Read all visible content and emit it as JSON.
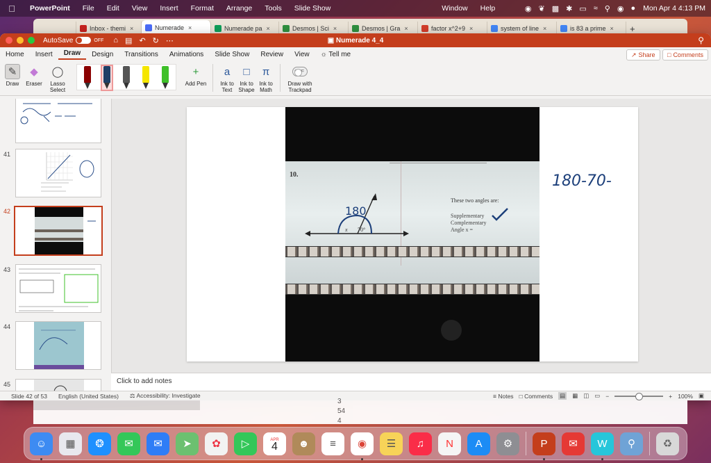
{
  "menubar": {
    "app_name": "PowerPoint",
    "items": [
      "File",
      "Edit",
      "View",
      "Insert",
      "Format",
      "Arrange",
      "Tools",
      "Slide Show",
      "Window",
      "Help"
    ],
    "clock": "Mon Apr 4  4:13 PM"
  },
  "browser_tabs": [
    {
      "label": "Inbox - themi",
      "color": "#c5221f"
    },
    {
      "label": "Numerade",
      "color": "#4a6cf7",
      "active": true
    },
    {
      "label": "Numerade pa",
      "color": "#0f9d58"
    },
    {
      "label": "Desmos | Sci",
      "color": "#2f8f3f"
    },
    {
      "label": "Desmos | Gra",
      "color": "#2f8f3f"
    },
    {
      "label": "factor x^2+9",
      "color": "#d23d2a"
    },
    {
      "label": "system of line",
      "color": "#4285f4"
    },
    {
      "label": "is 83 a prime",
      "color": "#4285f4"
    }
  ],
  "window": {
    "autosave_label": "AutoSave",
    "autosave_state": "OFF",
    "doc_title": "Numerade 4_4"
  },
  "ribbon_tabs": [
    "Home",
    "Insert",
    "Draw",
    "Design",
    "Transitions",
    "Animations",
    "Slide Show",
    "Review",
    "View",
    "Tell me"
  ],
  "ribbon_active_tab": "Draw",
  "share_label": "Share",
  "comments_label": "Comments",
  "ribbon_tools": {
    "draw": "Draw",
    "eraser": "Eraser",
    "lasso": "Lasso Select",
    "add_pen": "Add Pen",
    "ink_to_text": "Ink to Text",
    "ink_to_shape": "Ink to Shape",
    "ink_to_math": "Ink to Math",
    "draw_trackpad": "Draw with Trackpad",
    "trackpad_state": "OFF"
  },
  "pens": [
    {
      "color": "#8b0000"
    },
    {
      "color": "#1f3f66",
      "selected": true
    },
    {
      "color": "#555555"
    },
    {
      "color": "#f5e600"
    },
    {
      "color": "#3fc02a"
    }
  ],
  "thumbnails": [
    {
      "num": ""
    },
    {
      "num": "41"
    },
    {
      "num": "42",
      "active": true
    },
    {
      "num": "43"
    },
    {
      "num": "44"
    },
    {
      "num": "45"
    }
  ],
  "slide": {
    "problem_number": "10.",
    "handwritten_top": "180",
    "angle_x": "x",
    "angle_70": "70°",
    "q_title": "These two angles are:",
    "opt1": "Supplementary",
    "opt2": "Complementary",
    "opt3": "Angle x = ",
    "handwritten_right": "180-70-"
  },
  "notes_placeholder": "Click to add notes",
  "status": {
    "slide_info": "Slide 42 of 53",
    "language": "English (United States)",
    "accessibility": "Accessibility: Investigate",
    "notes": "Notes",
    "comments": "Comments",
    "zoom": "100%"
  },
  "behind_numbers": [
    "3",
    "54",
    "4"
  ],
  "dock_apps": [
    {
      "name": "Finder",
      "color": "#3d8bf2"
    },
    {
      "name": "Launchpad",
      "color": "#e8e8ee"
    },
    {
      "name": "Safari",
      "color": "#1e90ff"
    },
    {
      "name": "Messages",
      "color": "#34c759"
    },
    {
      "name": "Mail",
      "color": "#2f7df6"
    },
    {
      "name": "Maps",
      "color": "#6cc070"
    },
    {
      "name": "Photos",
      "color": "#f2f2f2"
    },
    {
      "name": "FaceTime",
      "color": "#34c759"
    },
    {
      "name": "Calendar",
      "color": "#ffffff"
    },
    {
      "name": "Contacts",
      "color": "#b08a5a"
    },
    {
      "name": "Reminders",
      "color": "#ffffff"
    },
    {
      "name": "Chrome",
      "color": "#ffffff"
    },
    {
      "name": "Notes",
      "color": "#f7d358"
    },
    {
      "name": "Music",
      "color": "#fa2d48"
    },
    {
      "name": "News",
      "color": "#f5f5f5"
    },
    {
      "name": "App Store",
      "color": "#1c8cf5"
    },
    {
      "name": "System Preferences",
      "color": "#8e8e93"
    },
    {
      "name": "PowerPoint",
      "color": "#c43e1c"
    },
    {
      "name": "Mail Alt",
      "color": "#e53935"
    },
    {
      "name": "Webex",
      "color": "#26c6da"
    },
    {
      "name": "Preview",
      "color": "#6fa3d6"
    },
    {
      "name": "Trash",
      "color": "#d8d8d8"
    }
  ],
  "calendar_icon": {
    "month": "APR",
    "day": "4"
  }
}
